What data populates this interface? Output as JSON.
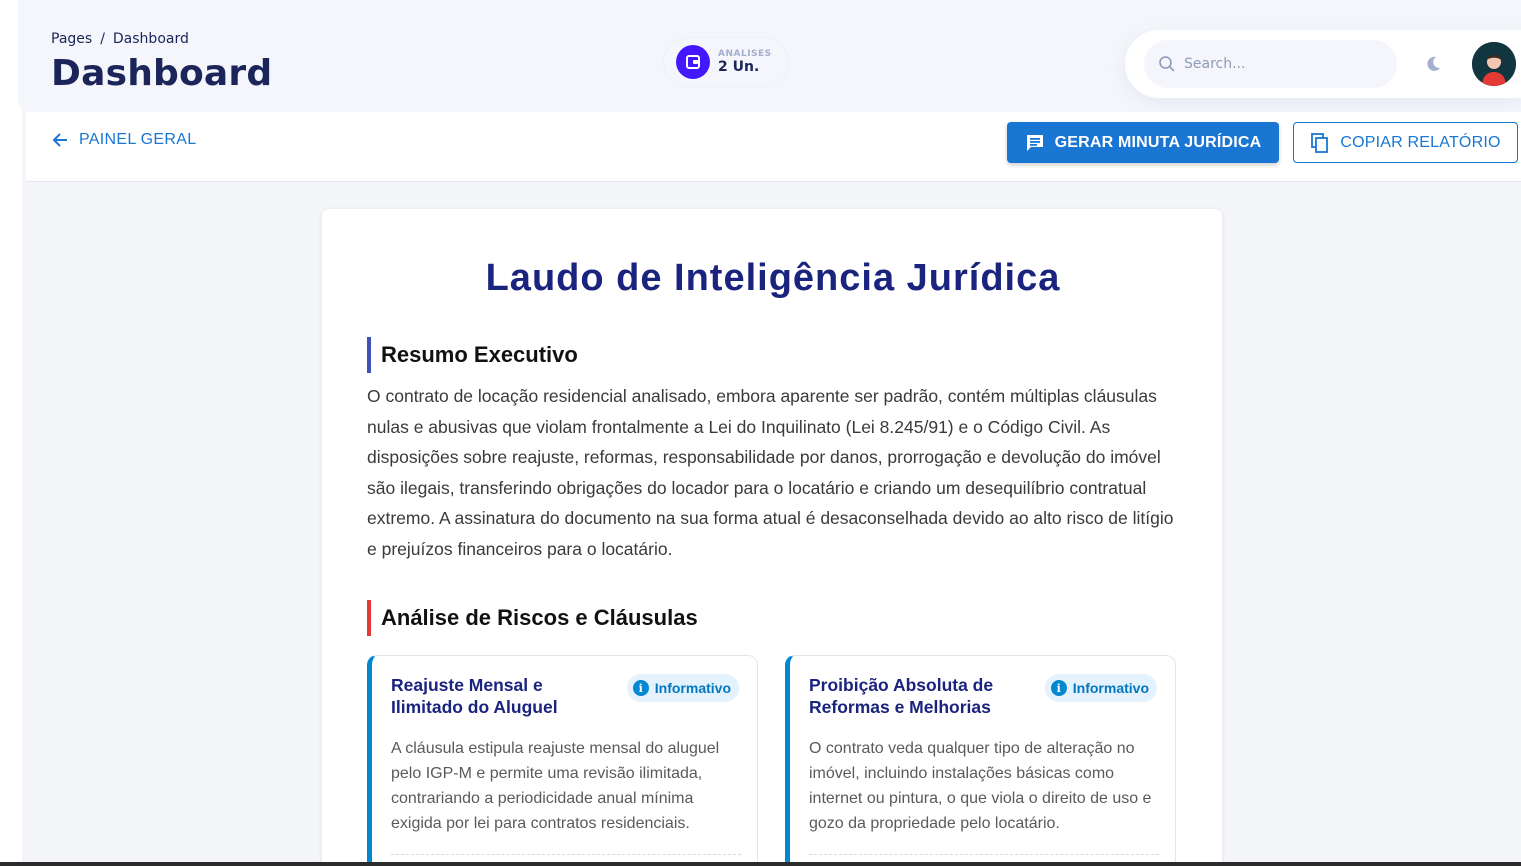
{
  "header": {
    "breadcrumb": {
      "root": "Pages",
      "separator": "/",
      "current": "Dashboard"
    },
    "title": "Dashboard",
    "stat": {
      "label": "ANALISES",
      "value": "2 Un."
    },
    "search": {
      "placeholder": "Search..."
    },
    "icons": {
      "search": "search-icon",
      "theme": "moon-icon",
      "avatar": "user-avatar"
    }
  },
  "toolbar": {
    "back_label": "PAINEL GERAL",
    "generate_label": "GERAR MINUTA JURÍDICA",
    "copy_label": "COPIAR RELATÓRIO"
  },
  "report": {
    "title": "Laudo de Inteligência Jurídica",
    "summary_heading": "Resumo Executivo",
    "summary_text": "O contrato de locação residencial analisado, embora aparente ser padrão, contém múltiplas cláusulas nulas e abusivas que violam frontalmente a Lei do Inquilinato (Lei 8.245/91) e o Código Civil. As disposições sobre reajuste, reformas, responsabilidade por danos, prorrogação e devolução do imóvel são ilegais, transferindo obrigações do locador para o locatário e criando um desequilíbrio contratual extremo. A assinatura do documento na sua forma atual é desaconselhada devido ao alto risco de litígio e prejuízos financeiros para o locatário.",
    "risks_heading": "Análise de Riscos e Cláusulas",
    "risks": [
      {
        "title": "Reajuste Mensal e Ilimitado do Aluguel",
        "badge": "Informativo",
        "description": "A cláusula estipula reajuste mensal do aluguel pelo IGP-M e permite uma revisão ilimitada, contrariando a periodicidade anual mínima exigida por lei para contratos residenciais."
      },
      {
        "title": "Proibição Absoluta de Reformas e Melhorias",
        "badge": "Informativo",
        "description": "O contrato veda qualquer tipo de alteração no imóvel, incluindo instalações básicas como internet ou pintura, o que viola o direito de uso e gozo da propriedade pelo locatário."
      }
    ]
  },
  "colors": {
    "primary": "#1976d2",
    "title_navy": "#1a237e",
    "header_text": "#1b2559",
    "stat_accent": "#4318ff",
    "risk_border": "#e53935",
    "summary_border": "#3f51b5",
    "info_border": "#0288d1"
  }
}
